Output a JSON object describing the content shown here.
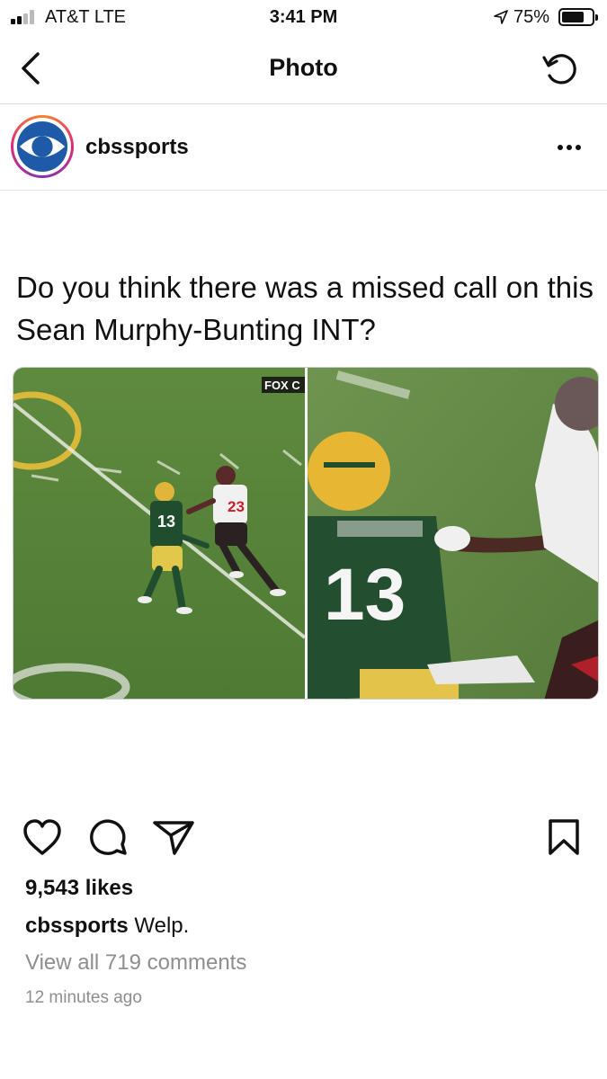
{
  "status_bar": {
    "carrier": "AT&T  LTE",
    "time": "3:41 PM",
    "battery_percent": "75%",
    "battery_level": 0.75,
    "signal_bars": 2
  },
  "nav": {
    "title": "Photo",
    "back_icon": "chevron-left-icon",
    "refresh_icon": "refresh-icon"
  },
  "post": {
    "username": "cbssports",
    "avatar_icon": "cbs-eye-logo",
    "more_icon": "more-horizontal-icon",
    "text": "Do you think there was a missed call on this Sean Murphy-Bunting INT?",
    "image": {
      "watermark": "FOX C",
      "left_jersey": "13",
      "right_jersey": "13",
      "defender_jersey": "23"
    },
    "actions": {
      "like_icon": "heart-icon",
      "comment_icon": "comment-icon",
      "share_icon": "send-icon",
      "save_icon": "bookmark-icon"
    },
    "likes": "9,543 likes",
    "caption_username": "cbssports",
    "caption": "Welp.",
    "view_comments": "View all 719 comments",
    "timestamp": "12 minutes ago"
  },
  "colors": {
    "text": "#111111",
    "secondary_text": "#8e8e8e",
    "divider": "#dbdbdb",
    "cbs_blue": "#1e5aa8"
  }
}
